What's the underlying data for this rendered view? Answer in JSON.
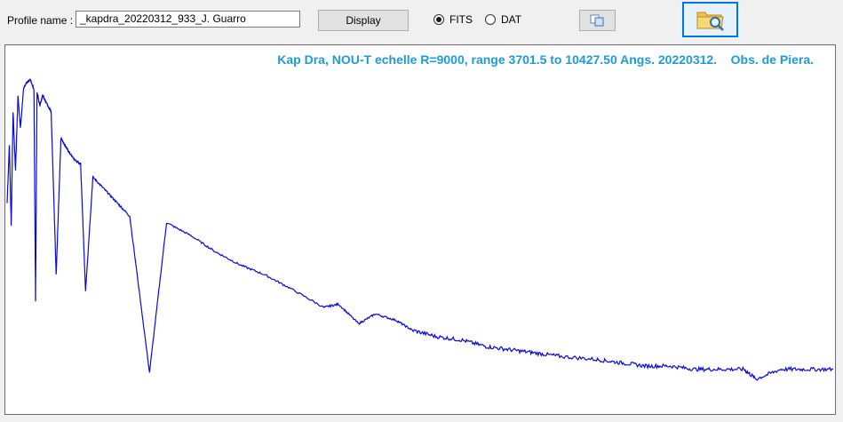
{
  "toolbar": {
    "profile_label": "Profile name :",
    "profile_value": "_kapdra_20220312_933_J. Guarro",
    "display_label": "Display",
    "radio_fits_label": "FITS",
    "radio_dat_label": "DAT",
    "selected_format": "FITS",
    "copy_icon": "copy-icon",
    "open_icon": "folder-search-icon"
  },
  "plot": {
    "title": "Kap Dra, NOU-T echelle R=9000, range 3701.5 to 10427.50 Angs. 20220312.    Obs. de Piera.",
    "line_color": "#0a0ad8",
    "title_color": "#1e9bd7"
  },
  "chart_data": {
    "type": "line",
    "title": "Kap Dra, NOU-T echelle R=9000, range 3701.5 to 10427.50 Angs. 20220312.    Obs. de Piera.",
    "xlabel": "",
    "ylabel": "",
    "xlim": [
      3701.5,
      10427.5
    ],
    "ylim": [
      0,
      1.05
    ],
    "grid": false,
    "series": [
      {
        "x": [
          3701.5,
          3720,
          3735,
          3750,
          3770,
          3790,
          3810,
          3835,
          3860,
          3890,
          3920,
          3933,
          3945,
          3968,
          3990,
          4020,
          4060,
          4101,
          4140,
          4200,
          4260,
          4300,
          4340,
          4400,
          4500,
          4600,
          4700,
          4861,
          5000,
          5200,
          5400,
          5600,
          5800,
          6000,
          6280,
          6400,
          6563,
          6700,
          6870,
          7000,
          7200,
          7400,
          7600,
          7800,
          8000,
          8200,
          8500,
          8700,
          8900,
          9100,
          9300,
          9500,
          9700,
          9800,
          10000,
          10200,
          10427.5
        ],
        "y": [
          0.62,
          0.8,
          0.55,
          0.9,
          0.72,
          0.95,
          0.85,
          0.97,
          0.99,
          1.0,
          0.97,
          0.32,
          0.96,
          0.92,
          0.95,
          0.93,
          0.9,
          0.4,
          0.82,
          0.78,
          0.75,
          0.74,
          0.35,
          0.7,
          0.66,
          0.62,
          0.58,
          0.1,
          0.56,
          0.52,
          0.47,
          0.43,
          0.4,
          0.36,
          0.3,
          0.31,
          0.25,
          0.28,
          0.26,
          0.23,
          0.21,
          0.2,
          0.18,
          0.17,
          0.16,
          0.15,
          0.14,
          0.13,
          0.12,
          0.12,
          0.11,
          0.11,
          0.11,
          0.08,
          0.11,
          0.11,
          0.11
        ]
      }
    ]
  }
}
